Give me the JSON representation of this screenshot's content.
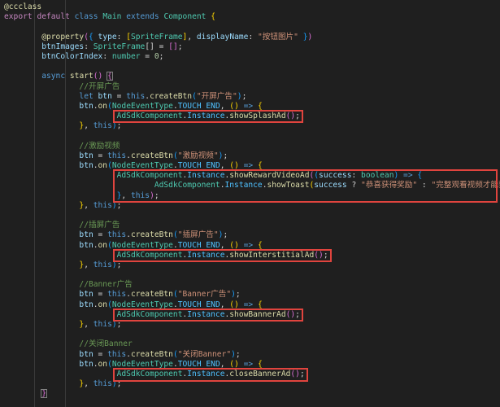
{
  "editor": {
    "theme": {
      "background": "#1f1f1f",
      "highlight_box_color": "#e0443e"
    },
    "lines": [
      [
        {
          "t": "@ccclass",
          "c": "fn"
        }
      ],
      [
        {
          "t": "export",
          "c": "ctl"
        },
        {
          "t": " "
        },
        {
          "t": "default",
          "c": "ctl"
        },
        {
          "t": " "
        },
        {
          "t": "class",
          "c": "kw"
        },
        {
          "t": " "
        },
        {
          "t": "Main",
          "c": "ty"
        },
        {
          "t": " "
        },
        {
          "t": "extends",
          "c": "kw"
        },
        {
          "t": " "
        },
        {
          "t": "Component",
          "c": "ty"
        },
        {
          "t": " "
        },
        {
          "t": "{",
          "c": "br1"
        }
      ],
      [],
      [
        {
          "t": "        "
        },
        {
          "t": "@property",
          "c": "fn"
        },
        {
          "t": "(",
          "c": "br2"
        },
        {
          "t": "{",
          "c": "br3"
        },
        {
          "t": " "
        },
        {
          "t": "type",
          "c": "var"
        },
        {
          "t": ": "
        },
        {
          "t": "[",
          "c": "br1"
        },
        {
          "t": "SpriteFrame",
          "c": "ty"
        },
        {
          "t": "]",
          "c": "br1"
        },
        {
          "t": ", "
        },
        {
          "t": "displayName",
          "c": "var"
        },
        {
          "t": ": "
        },
        {
          "t": "\"按钮图片\"",
          "c": "str"
        },
        {
          "t": " "
        },
        {
          "t": "}",
          "c": "br3"
        },
        {
          "t": ")",
          "c": "br2"
        }
      ],
      [
        {
          "t": "        "
        },
        {
          "t": "btnImages",
          "c": "var"
        },
        {
          "t": ": "
        },
        {
          "t": "SpriteFrame",
          "c": "ty"
        },
        {
          "t": "[] = "
        },
        {
          "t": "[]",
          "c": "br2"
        },
        {
          "t": ";"
        }
      ],
      [
        {
          "t": "        "
        },
        {
          "t": "btnColorIndex",
          "c": "var"
        },
        {
          "t": ": "
        },
        {
          "t": "number",
          "c": "ty"
        },
        {
          "t": " = "
        },
        {
          "t": "0",
          "c": "num"
        },
        {
          "t": ";"
        }
      ],
      [],
      [
        {
          "t": "        "
        },
        {
          "t": "async",
          "c": "kw"
        },
        {
          "t": " "
        },
        {
          "t": "start",
          "c": "fn"
        },
        {
          "t": "()",
          "c": "br2"
        },
        {
          "t": " "
        },
        {
          "t": "{",
          "c": "br2",
          "box": true
        }
      ],
      [
        {
          "t": "                "
        },
        {
          "t": "//开屏广告",
          "c": "cmt"
        }
      ],
      [
        {
          "t": "                "
        },
        {
          "t": "let",
          "c": "kw"
        },
        {
          "t": " "
        },
        {
          "t": "btn",
          "c": "var"
        },
        {
          "t": " = "
        },
        {
          "t": "this",
          "c": "kw"
        },
        {
          "t": "."
        },
        {
          "t": "createBtn",
          "c": "fn"
        },
        {
          "t": "(",
          "c": "br3"
        },
        {
          "t": "\"开屏广告\"",
          "c": "str"
        },
        {
          "t": ")",
          "c": "br3"
        },
        {
          "t": ";"
        }
      ],
      [
        {
          "t": "                "
        },
        {
          "t": "btn",
          "c": "var"
        },
        {
          "t": "."
        },
        {
          "t": "on",
          "c": "fn"
        },
        {
          "t": "(",
          "c": "br3"
        },
        {
          "t": "NodeEventType",
          "c": "ty"
        },
        {
          "t": "."
        },
        {
          "t": "TOUCH_END",
          "c": "cst"
        },
        {
          "t": ", "
        },
        {
          "t": "()",
          "c": "br1"
        },
        {
          "t": " "
        },
        {
          "t": "=>",
          "c": "kw"
        },
        {
          "t": " "
        },
        {
          "t": "{",
          "c": "br1"
        }
      ],
      [
        {
          "t": "                        "
        },
        {
          "t": "AdSdkComponent",
          "c": "ty"
        },
        {
          "t": "."
        },
        {
          "t": "Instance",
          "c": "cst"
        },
        {
          "t": "."
        },
        {
          "t": "showSplashAd",
          "c": "fn"
        },
        {
          "t": "()",
          "c": "br2"
        },
        {
          "t": ";"
        }
      ],
      [
        {
          "t": "                "
        },
        {
          "t": "}",
          "c": "br1"
        },
        {
          "t": ", "
        },
        {
          "t": "this",
          "c": "kw"
        },
        {
          "t": ")",
          "c": "br3"
        },
        {
          "t": ";"
        }
      ],
      [],
      [
        {
          "t": "                "
        },
        {
          "t": "//激励视频",
          "c": "cmt"
        }
      ],
      [
        {
          "t": "                "
        },
        {
          "t": "btn",
          "c": "var"
        },
        {
          "t": " = "
        },
        {
          "t": "this",
          "c": "kw"
        },
        {
          "t": "."
        },
        {
          "t": "createBtn",
          "c": "fn"
        },
        {
          "t": "(",
          "c": "br3"
        },
        {
          "t": "\"激励视频\"",
          "c": "str"
        },
        {
          "t": ")",
          "c": "br3"
        },
        {
          "t": ";"
        }
      ],
      [
        {
          "t": "                "
        },
        {
          "t": "btn",
          "c": "var"
        },
        {
          "t": "."
        },
        {
          "t": "on",
          "c": "fn"
        },
        {
          "t": "(",
          "c": "br3"
        },
        {
          "t": "NodeEventType",
          "c": "ty"
        },
        {
          "t": "."
        },
        {
          "t": "TOUCH_END",
          "c": "cst"
        },
        {
          "t": ", "
        },
        {
          "t": "()",
          "c": "br1"
        },
        {
          "t": " "
        },
        {
          "t": "=>",
          "c": "kw"
        },
        {
          "t": " "
        },
        {
          "t": "{",
          "c": "br1"
        }
      ],
      [
        {
          "t": "                        "
        },
        {
          "t": "AdSdkComponent",
          "c": "ty"
        },
        {
          "t": "."
        },
        {
          "t": "Instance",
          "c": "cst"
        },
        {
          "t": "."
        },
        {
          "t": "showRewardVideoAd",
          "c": "fn"
        },
        {
          "t": "(",
          "c": "br2"
        },
        {
          "t": "(",
          "c": "br3"
        },
        {
          "t": "success",
          "c": "var"
        },
        {
          "t": ": "
        },
        {
          "t": "boolean",
          "c": "ty"
        },
        {
          "t": ")",
          "c": "br3"
        },
        {
          "t": " "
        },
        {
          "t": "=>",
          "c": "kw"
        },
        {
          "t": " "
        },
        {
          "t": "{",
          "c": "br3"
        }
      ],
      [
        {
          "t": "                                "
        },
        {
          "t": "AdSdkComponent",
          "c": "ty"
        },
        {
          "t": "."
        },
        {
          "t": "Instance",
          "c": "cst"
        },
        {
          "t": "."
        },
        {
          "t": "showToast",
          "c": "fn"
        },
        {
          "t": "(",
          "c": "br1"
        },
        {
          "t": "success",
          "c": "var"
        },
        {
          "t": " ? "
        },
        {
          "t": "\"恭喜获得奖励\"",
          "c": "str"
        },
        {
          "t": " : "
        },
        {
          "t": "\"完整观看视频才能获得奖励哦\"",
          "c": "str"
        },
        {
          "t": ")",
          "c": "br1"
        },
        {
          "t": ";"
        }
      ],
      [
        {
          "t": "                        "
        },
        {
          "t": "}",
          "c": "br3"
        },
        {
          "t": ", "
        },
        {
          "t": "this",
          "c": "kw"
        },
        {
          "t": ")",
          "c": "br2"
        },
        {
          "t": ";"
        }
      ],
      [
        {
          "t": "                "
        },
        {
          "t": "}",
          "c": "br1"
        },
        {
          "t": ", "
        },
        {
          "t": "this",
          "c": "kw"
        },
        {
          "t": ")",
          "c": "br3"
        },
        {
          "t": ";"
        }
      ],
      [],
      [
        {
          "t": "                "
        },
        {
          "t": "//插屏广告",
          "c": "cmt"
        }
      ],
      [
        {
          "t": "                "
        },
        {
          "t": "btn",
          "c": "var"
        },
        {
          "t": " = "
        },
        {
          "t": "this",
          "c": "kw"
        },
        {
          "t": "."
        },
        {
          "t": "createBtn",
          "c": "fn"
        },
        {
          "t": "(",
          "c": "br3"
        },
        {
          "t": "\"插屏广告\"",
          "c": "str"
        },
        {
          "t": ")",
          "c": "br3"
        },
        {
          "t": ";"
        }
      ],
      [
        {
          "t": "                "
        },
        {
          "t": "btn",
          "c": "var"
        },
        {
          "t": "."
        },
        {
          "t": "on",
          "c": "fn"
        },
        {
          "t": "(",
          "c": "br3"
        },
        {
          "t": "NodeEventType",
          "c": "ty"
        },
        {
          "t": "."
        },
        {
          "t": "TOUCH_END",
          "c": "cst"
        },
        {
          "t": ", "
        },
        {
          "t": "()",
          "c": "br1"
        },
        {
          "t": " "
        },
        {
          "t": "=>",
          "c": "kw"
        },
        {
          "t": " "
        },
        {
          "t": "{",
          "c": "br1"
        }
      ],
      [
        {
          "t": "                        "
        },
        {
          "t": "AdSdkComponent",
          "c": "ty"
        },
        {
          "t": "."
        },
        {
          "t": "Instance",
          "c": "cst"
        },
        {
          "t": "."
        },
        {
          "t": "showInterstitialAd",
          "c": "fn"
        },
        {
          "t": "()",
          "c": "br2"
        },
        {
          "t": ";"
        }
      ],
      [
        {
          "t": "                "
        },
        {
          "t": "}",
          "c": "br1"
        },
        {
          "t": ", "
        },
        {
          "t": "this",
          "c": "kw"
        },
        {
          "t": ")",
          "c": "br3"
        },
        {
          "t": ";"
        }
      ],
      [],
      [
        {
          "t": "                "
        },
        {
          "t": "//Banner广告",
          "c": "cmt"
        }
      ],
      [
        {
          "t": "                "
        },
        {
          "t": "btn",
          "c": "var"
        },
        {
          "t": " = "
        },
        {
          "t": "this",
          "c": "kw"
        },
        {
          "t": "."
        },
        {
          "t": "createBtn",
          "c": "fn"
        },
        {
          "t": "(",
          "c": "br3"
        },
        {
          "t": "\"Banner广告\"",
          "c": "str"
        },
        {
          "t": ")",
          "c": "br3"
        },
        {
          "t": ";"
        }
      ],
      [
        {
          "t": "                "
        },
        {
          "t": "btn",
          "c": "var"
        },
        {
          "t": "."
        },
        {
          "t": "on",
          "c": "fn"
        },
        {
          "t": "(",
          "c": "br3"
        },
        {
          "t": "NodeEventType",
          "c": "ty"
        },
        {
          "t": "."
        },
        {
          "t": "TOUCH_END",
          "c": "cst"
        },
        {
          "t": ", "
        },
        {
          "t": "()",
          "c": "br1"
        },
        {
          "t": " "
        },
        {
          "t": "=>",
          "c": "kw"
        },
        {
          "t": " "
        },
        {
          "t": "{",
          "c": "br1"
        }
      ],
      [
        {
          "t": "                        "
        },
        {
          "t": "AdSdkComponent",
          "c": "ty"
        },
        {
          "t": "."
        },
        {
          "t": "Instance",
          "c": "cst"
        },
        {
          "t": "."
        },
        {
          "t": "showBannerAd",
          "c": "fn"
        },
        {
          "t": "()",
          "c": "br2"
        },
        {
          "t": ";"
        }
      ],
      [
        {
          "t": "                "
        },
        {
          "t": "}",
          "c": "br1"
        },
        {
          "t": ", "
        },
        {
          "t": "this",
          "c": "kw"
        },
        {
          "t": ")",
          "c": "br3"
        },
        {
          "t": ";"
        }
      ],
      [],
      [
        {
          "t": "                "
        },
        {
          "t": "//关闭Banner",
          "c": "cmt"
        }
      ],
      [
        {
          "t": "                "
        },
        {
          "t": "btn",
          "c": "var"
        },
        {
          "t": " = "
        },
        {
          "t": "this",
          "c": "kw"
        },
        {
          "t": "."
        },
        {
          "t": "createBtn",
          "c": "fn"
        },
        {
          "t": "(",
          "c": "br3"
        },
        {
          "t": "\"关闭Banner\"",
          "c": "str"
        },
        {
          "t": ")",
          "c": "br3"
        },
        {
          "t": ";"
        }
      ],
      [
        {
          "t": "                "
        },
        {
          "t": "btn",
          "c": "var"
        },
        {
          "t": "."
        },
        {
          "t": "on",
          "c": "fn"
        },
        {
          "t": "(",
          "c": "br3"
        },
        {
          "t": "NodeEventType",
          "c": "ty"
        },
        {
          "t": "."
        },
        {
          "t": "TOUCH_END",
          "c": "cst"
        },
        {
          "t": ", "
        },
        {
          "t": "()",
          "c": "br1"
        },
        {
          "t": " "
        },
        {
          "t": "=>",
          "c": "kw"
        },
        {
          "t": " "
        },
        {
          "t": "{",
          "c": "br1"
        }
      ],
      [
        {
          "t": "                        "
        },
        {
          "t": "AdSdkComponent",
          "c": "ty"
        },
        {
          "t": "."
        },
        {
          "t": "Instance",
          "c": "cst"
        },
        {
          "t": "."
        },
        {
          "t": "closeBannerAd",
          "c": "fn"
        },
        {
          "t": "()",
          "c": "br2"
        },
        {
          "t": ";"
        }
      ],
      [
        {
          "t": "                "
        },
        {
          "t": "}",
          "c": "br1"
        },
        {
          "t": ", "
        },
        {
          "t": "this",
          "c": "kw"
        },
        {
          "t": ")",
          "c": "br3"
        },
        {
          "t": ";"
        }
      ],
      [
        {
          "t": "        "
        },
        {
          "t": "}",
          "c": "br2",
          "box": true
        }
      ]
    ],
    "highlights": [
      {
        "name": "highlight-show-splash-ad",
        "rows": [
          11,
          11
        ]
      },
      {
        "name": "highlight-show-reward-video-ad",
        "rows": [
          17,
          19
        ]
      },
      {
        "name": "highlight-show-interstitial-ad",
        "rows": [
          25,
          25
        ]
      },
      {
        "name": "highlight-show-banner-ad",
        "rows": [
          31,
          31
        ]
      },
      {
        "name": "highlight-close-banner-ad",
        "rows": [
          37,
          37
        ]
      }
    ]
  }
}
